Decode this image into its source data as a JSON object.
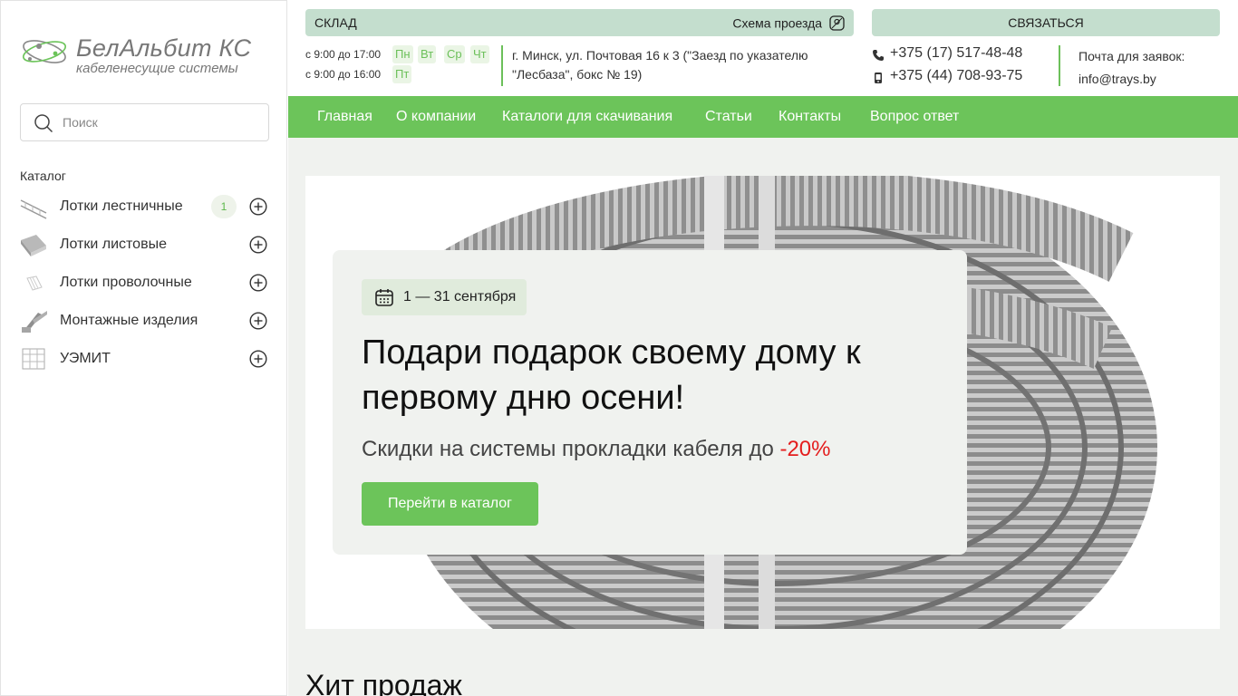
{
  "logo": {
    "name": "БелАльбит КС",
    "tagline": "кабеленесущие системы"
  },
  "search": {
    "placeholder": "Поиск"
  },
  "catalog": {
    "title": "Каталог",
    "items": [
      {
        "label": "Лотки лестничные",
        "badge": "1"
      },
      {
        "label": "Лотки листовые"
      },
      {
        "label": "Лотки проволочные"
      },
      {
        "label": "Монтажные изделия"
      },
      {
        "label": "УЭМИТ"
      }
    ]
  },
  "topbar": {
    "warehouse_label": "СКЛАД",
    "map_label": "Схема проезда",
    "contact_label": "СВЯЗАТЬСЯ",
    "hours": [
      {
        "time": "с 9:00 до 17:00",
        "days": [
          "Пн",
          "Вт",
          "Ср",
          "Чт"
        ]
      },
      {
        "time": "с 9:00 до 16:00",
        "days": [
          "Пт"
        ]
      }
    ],
    "address": "г. Минск, ул. Почтовая 16 к 3 (\"Заезд по указателю \"Лесбаза\", бокс № 19)",
    "phones": [
      "+375 (17) 517-48-48",
      "+375 (44) 708-93-75"
    ],
    "mail_label": "Почта для заявок:",
    "mail": "info@trays.by"
  },
  "nav": [
    "Главная",
    "О компании",
    "Каталоги для скачивания",
    "Статьи",
    "Контакты",
    "Вопрос ответ"
  ],
  "hero": {
    "date": "1 — 31 сентября",
    "headline": "Подари подарок своему дому к первому дню осени!",
    "sub_text": "Скидки на системы прокладки кабеля до ",
    "sub_accent": "-20%",
    "cta": "Перейти в каталог"
  },
  "section": {
    "title": "Хит продаж"
  },
  "colors": {
    "brand_green": "#6cc45a",
    "info_bar": "#c4dece",
    "accent_red": "#e41e1e"
  }
}
